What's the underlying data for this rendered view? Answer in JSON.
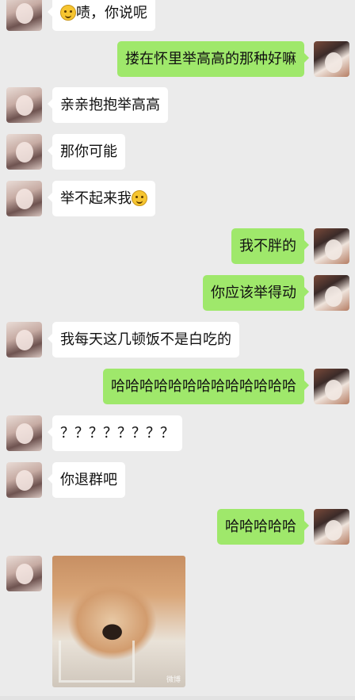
{
  "messages": [
    {
      "side": "left",
      "text": "啧，你说呢",
      "emoji_prefix": true
    },
    {
      "side": "right",
      "text": "搂在怀里举高高的那种好嘛"
    },
    {
      "side": "left",
      "text": "亲亲抱抱举高高"
    },
    {
      "side": "left",
      "text": "那你可能"
    },
    {
      "side": "left",
      "text": "举不起来我",
      "emoji_suffix": true
    },
    {
      "side": "right",
      "text": "我不胖的"
    },
    {
      "side": "right",
      "text": "你应该举得动"
    },
    {
      "side": "left",
      "text": "我每天这几顿饭不是白吃的"
    },
    {
      "side": "right",
      "text": "哈哈哈哈哈哈哈哈哈哈哈哈哈"
    },
    {
      "side": "left",
      "text": "？？？？？？？？"
    },
    {
      "side": "left",
      "text": "你退群吧"
    },
    {
      "side": "right",
      "text": "哈哈哈哈哈"
    },
    {
      "side": "left",
      "type": "sticker",
      "watermark": "微博"
    }
  ],
  "colors": {
    "background": "#ebebeb",
    "bubble_left": "#ffffff",
    "bubble_right": "#9fe86b"
  },
  "icons": {
    "emoji": "smiling-face-emoji",
    "avatar_left": "contact-avatar",
    "avatar_right": "self-avatar"
  }
}
